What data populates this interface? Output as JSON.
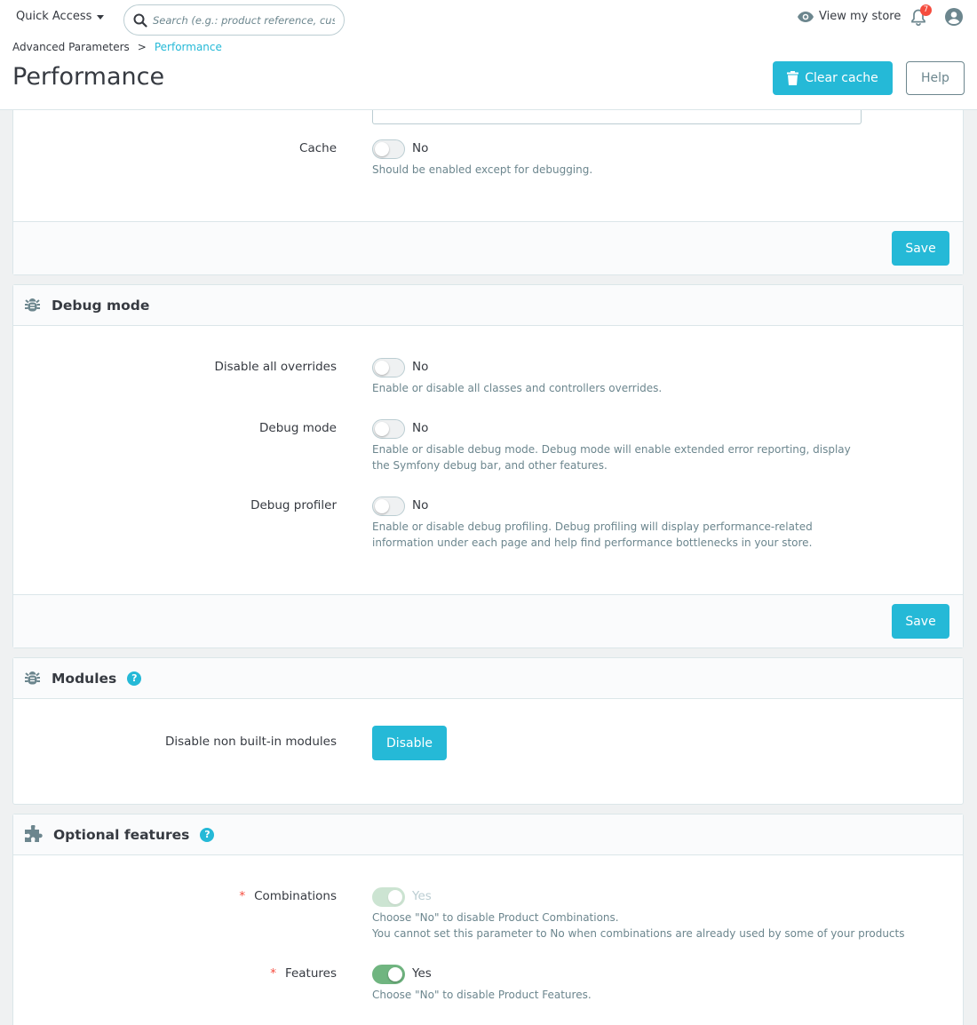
{
  "header": {
    "quick_access": "Quick Access",
    "search_placeholder": "Search (e.g.: product reference, custon",
    "view_store": "View my store",
    "notifications_count": "7"
  },
  "breadcrumb": {
    "parent": "Advanced Parameters",
    "separator": ">",
    "current": "Performance"
  },
  "page": {
    "title": "Performance",
    "clear_cache_label": "Clear cache",
    "help_label": "Help"
  },
  "cache_card": {
    "cache_label": "Cache",
    "cache_value": "No",
    "cache_help": "Should be enabled except for debugging.",
    "save_label": "Save"
  },
  "debug_card": {
    "title": "Debug mode",
    "disable_overrides_label": "Disable all overrides",
    "disable_overrides_value": "No",
    "disable_overrides_help": "Enable or disable all classes and controllers overrides.",
    "debug_mode_label": "Debug mode",
    "debug_mode_value": "No",
    "debug_mode_help": "Enable or disable debug mode. Debug mode will enable extended error reporting, display the Symfony debug bar, and other features.",
    "debug_profiler_label": "Debug profiler",
    "debug_profiler_value": "No",
    "debug_profiler_help": "Enable or disable debug profiling. Debug profiling will display performance-related information under each page and help find performance bottlenecks in your store.",
    "save_label": "Save"
  },
  "modules_card": {
    "title": "Modules",
    "help_symbol": "?",
    "disable_modules_label": "Disable non built-in modules",
    "disable_button": "Disable"
  },
  "optional_card": {
    "title": "Optional features",
    "help_symbol": "?",
    "required_mark": "*",
    "combinations_label": "Combinations",
    "combinations_value": "Yes",
    "combinations_help_1": "Choose \"No\" to disable Product Combinations.",
    "combinations_help_2": "You cannot set this parameter to No when combinations are already used by some of your products",
    "features_label": "Features",
    "features_value": "Yes",
    "features_help": "Choose \"No\" to disable Product Features."
  },
  "colors": {
    "primary": "#25b9d7",
    "success": "#70b580",
    "danger": "#f54c3e",
    "text": "#363a41",
    "muted": "#6c868e"
  }
}
